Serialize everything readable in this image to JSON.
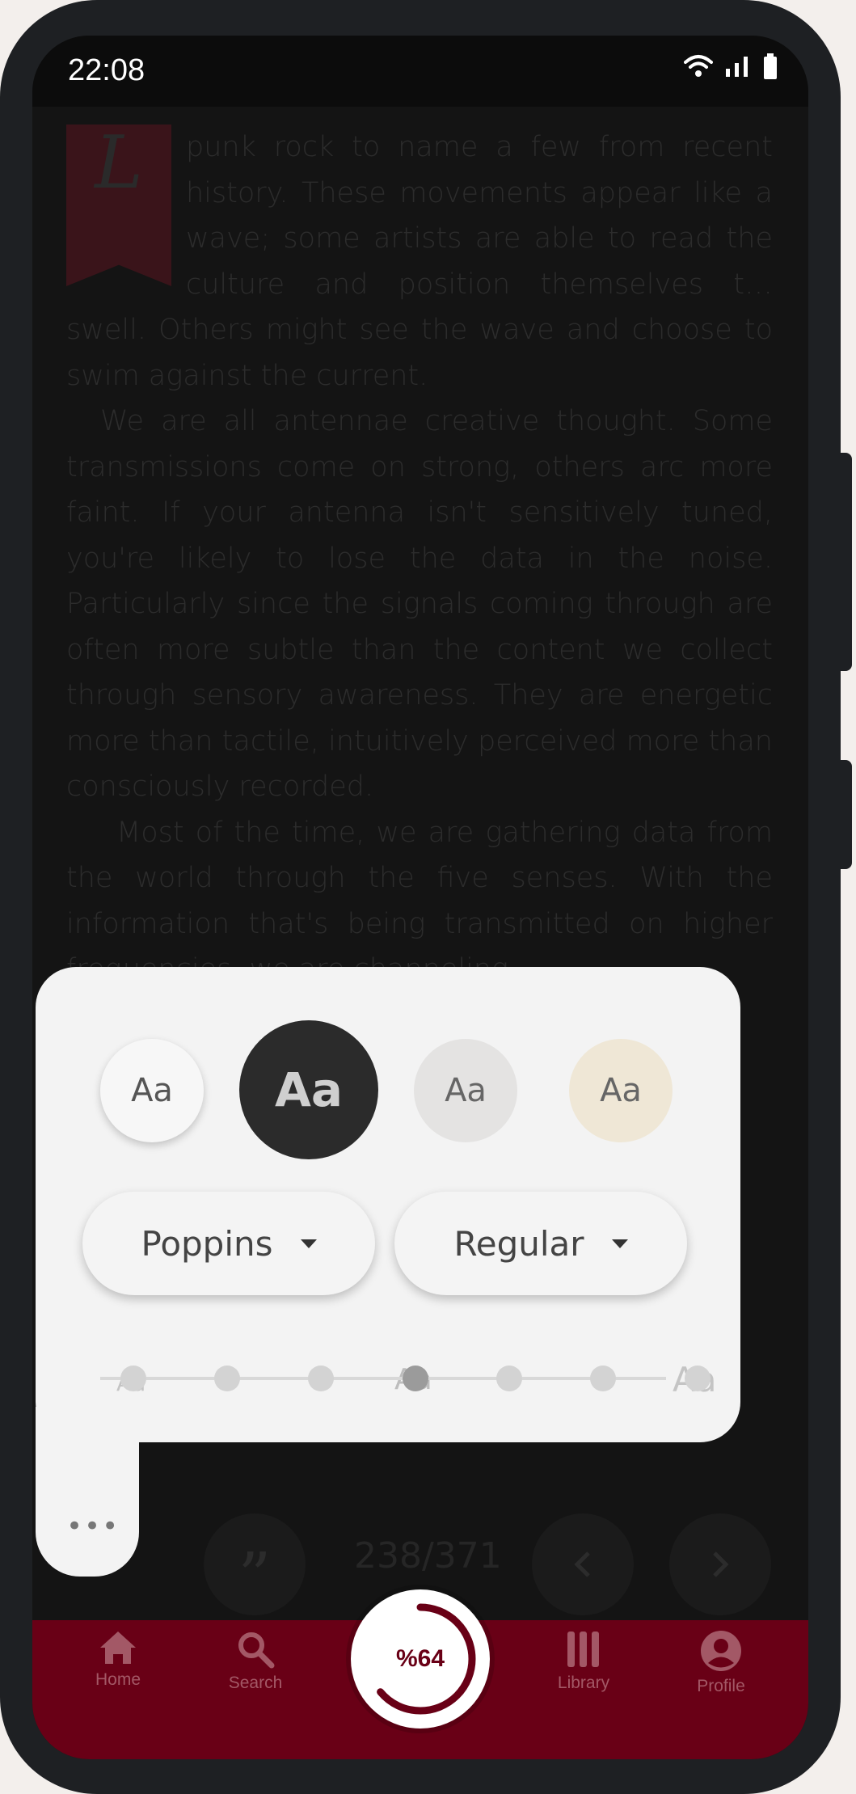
{
  "status": {
    "time": "22:08"
  },
  "reading": {
    "drop_cap": "L",
    "paragraph1": "punk rock to name a few from recent history. These movements appear like a wave; some artists are able to read the culture and position themselves t… swell. Others might see the wave and choose to swim against the current.",
    "paragraph2": "We are all antennae creative thought. Some transmissions come on strong, others arc more faint. If your antenna isn't sensitively tuned, you're likely to lose the data in the noise. Particularly since the signals coming through are often more subtle than the content we collect through sensory awareness. They are energetic more than tactile, intuitively perceived more than consciously recorded.",
    "paragraph3": "Most of the time, we are gathering data from the world through the five senses. With the information that's being transmitted on higher frequencies, we are channeling"
  },
  "settings_panel": {
    "themes": [
      {
        "label": "Aa",
        "name": "light",
        "color": "#f7f7f7"
      },
      {
        "label": "Aa",
        "name": "dark",
        "color": "#2b2b2b",
        "selected": true
      },
      {
        "label": "Aa",
        "name": "paper-grey",
        "color": "#e4e3e2"
      },
      {
        "label": "Aa",
        "name": "paper-cream",
        "color": "#efe7d6"
      }
    ],
    "font_family": "Poppins",
    "font_weight": "Regular",
    "size_labels": {
      "small": "Aa",
      "medium": "Aa",
      "large": "Aa"
    },
    "size_steps": 7,
    "size_selected_index": 3,
    "more_icon": "more-dots"
  },
  "reader_controls": {
    "page_count": "238/371",
    "quote_icon": "quote-icon",
    "prev_icon": "chevron-left",
    "next_icon": "chevron-right"
  },
  "progress": {
    "label": "%64",
    "fraction": 0.64
  },
  "navbar": {
    "items": [
      {
        "label": "Home",
        "icon": "home-icon"
      },
      {
        "label": "Search",
        "icon": "search-icon"
      },
      {
        "label": "Library",
        "icon": "library-icon"
      },
      {
        "label": "Profile",
        "icon": "profile-icon"
      }
    ]
  },
  "colors": {
    "brand": "#690016",
    "nav_icon": "#a35866"
  }
}
